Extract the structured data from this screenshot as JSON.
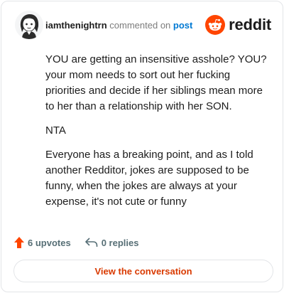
{
  "comment": {
    "username": "iamthenightrn",
    "verb": "commented on",
    "target": "post",
    "paragraphs": [
      "YOU are getting an insensitive asshole? YOU? your mom needs to sort out her fucking priorities and decide if her siblings mean more to her than a relationship with her SON.",
      "NTA",
      "Everyone has a breaking point, and as I told another Redditor, jokes are supposed to be funny, when the jokes are always at your expense, it's not cute or funny"
    ]
  },
  "brand": {
    "name": "reddit",
    "color": "#ff4500"
  },
  "stats": {
    "upvotes_label": "6 upvotes",
    "replies_label": "0 replies",
    "upvote_color": "#ff4500"
  },
  "cta": {
    "label": "View the conversation",
    "color": "#d93a00"
  },
  "icons": {
    "avatar": "avatar-icon",
    "logo": "reddit-logo-icon",
    "upvote": "upvote-arrow-icon",
    "reply": "reply-arrow-icon"
  }
}
